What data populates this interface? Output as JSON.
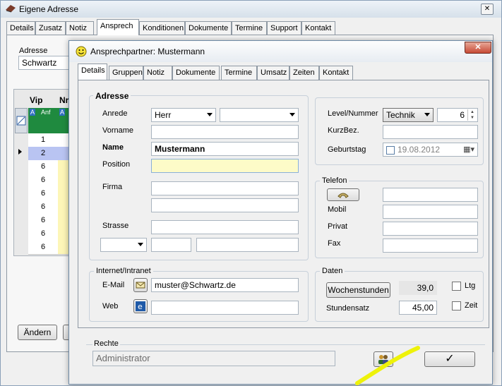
{
  "back_window": {
    "title": "Eigene Adresse",
    "tabs": [
      "Details",
      "Zusatz",
      "Notiz",
      "Ansprech",
      "Konditionen",
      "Dokumente",
      "Termine",
      "Support",
      "Kontakt"
    ],
    "active_tab_index": 3,
    "adresse_label": "Adresse",
    "adresse_value": "Schwartz",
    "grid": {
      "headers": [
        "Vip",
        "Nr"
      ],
      "filter_tags": [
        "Anf"
      ],
      "rows": [
        "1",
        "2",
        "6",
        "6",
        "6",
        "6",
        "6",
        "6",
        "6"
      ],
      "selected_row_index": 1
    },
    "aendern_button": "Ändern"
  },
  "dialog": {
    "title": "Ansprechpartner: Mustermann",
    "tabs": [
      "Details",
      "Gruppen",
      "Notiz",
      "Dokumente",
      "Termine",
      "Umsatz",
      "Zeiten",
      "Kontakt"
    ],
    "active_tab_index": 0,
    "adresse": {
      "heading": "Adresse",
      "anrede_label": "Anrede",
      "anrede_value": "Herr",
      "vorname_label": "Vorname",
      "name_label": "Name",
      "name_value": "Mustermann",
      "position_label": "Position",
      "firma_label": "Firma",
      "strasse_label": "Strasse"
    },
    "right_top": {
      "level_label": "Level/Nummer",
      "level_value": "Technik",
      "nummer_value": "6",
      "kurzbez_label": "KurzBez.",
      "geburtstag_label": "Geburtstag",
      "geburtstag_value": "19.08.2012"
    },
    "telefon": {
      "title": "Telefon",
      "mobil_label": "Mobil",
      "privat_label": "Privat",
      "fax_label": "Fax"
    },
    "internet": {
      "title": "Internet/Intranet",
      "email_label": "E-Mail",
      "email_value": "muster@Schwartz.de",
      "web_label": "Web"
    },
    "daten": {
      "title": "Daten",
      "wochenstunden_button": "Wochenstunden",
      "wochenstunden_value": "39,0",
      "ltg_label": "Ltg",
      "stundensatz_label": "Stundensatz",
      "stundensatz_value": "45,00",
      "zeit_label": "Zeit"
    },
    "rechte": {
      "title": "Rechte",
      "value": "Administrator"
    },
    "ok_glyph": "✓"
  },
  "colors": {
    "position_field_bg": "#fdfbc8",
    "grid_header_green": "#1f8a3f",
    "grid_yellow": "#fdf6b8",
    "grid_selected": "#b9c4f2",
    "highlight_stroke": "#eef20a"
  }
}
